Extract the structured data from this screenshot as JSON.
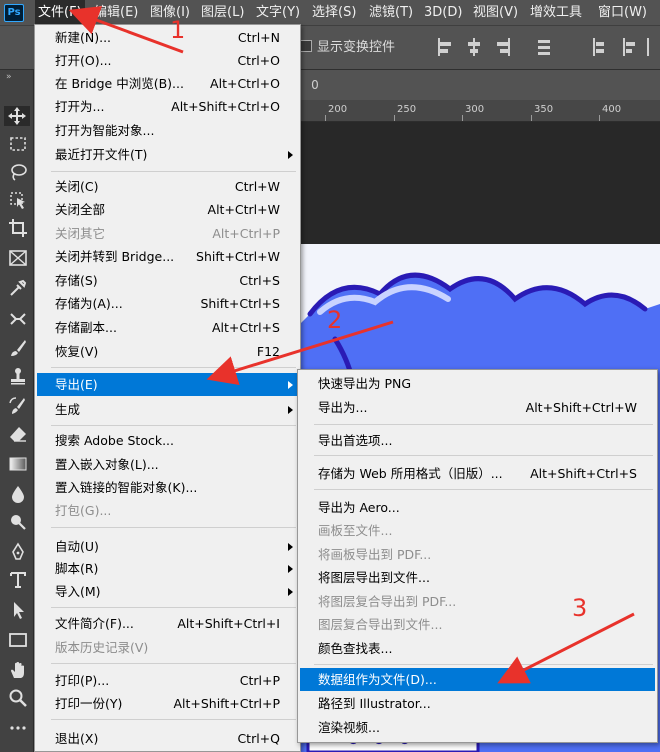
{
  "app": {
    "logo_text": "Ps"
  },
  "menubar": {
    "items": [
      "文件(F)",
      "编辑(E)",
      "图像(I)",
      "图层(L)",
      "文字(Y)",
      "选择(S)",
      "滤镜(T)",
      "3D(D)",
      "视图(V)",
      "增效工具",
      "窗口(W)"
    ]
  },
  "options_bar": {
    "show_transform_controls": "显示变换控件"
  },
  "document": {
    "tab_label": "0"
  },
  "ruler": {
    "ticks": [
      "200",
      "250",
      "300",
      "350",
      "400"
    ]
  },
  "file_menu": {
    "items": [
      {
        "label": "新建(N)...",
        "shortcut": "Ctrl+N",
        "disabled": false
      },
      {
        "label": "打开(O)...",
        "shortcut": "Ctrl+O",
        "disabled": false
      },
      {
        "label": "在 Bridge 中浏览(B)...",
        "shortcut": "Alt+Ctrl+O",
        "disabled": false
      },
      {
        "label": "打开为...",
        "shortcut": "Alt+Shift+Ctrl+O",
        "disabled": false
      },
      {
        "label": "打开为智能对象...",
        "shortcut": "",
        "disabled": false
      },
      {
        "label": "最近打开文件(T)",
        "shortcut": "",
        "disabled": false,
        "submenu": true
      },
      {
        "label": "关闭(C)",
        "shortcut": "Ctrl+W",
        "disabled": false
      },
      {
        "label": "关闭全部",
        "shortcut": "Alt+Ctrl+W",
        "disabled": false
      },
      {
        "label": "关闭其它",
        "shortcut": "Alt+Ctrl+P",
        "disabled": true
      },
      {
        "label": "关闭并转到 Bridge...",
        "shortcut": "Shift+Ctrl+W",
        "disabled": false
      },
      {
        "label": "存储(S)",
        "shortcut": "Ctrl+S",
        "disabled": false
      },
      {
        "label": "存储为(A)...",
        "shortcut": "Shift+Ctrl+S",
        "disabled": false
      },
      {
        "label": "存储副本...",
        "shortcut": "Alt+Ctrl+S",
        "disabled": false
      },
      {
        "label": "恢复(V)",
        "shortcut": "F12",
        "disabled": false
      },
      {
        "label": "导出(E)",
        "shortcut": "",
        "disabled": false,
        "submenu": true,
        "highlighted": true
      },
      {
        "label": "生成",
        "shortcut": "",
        "disabled": false,
        "submenu": true
      },
      {
        "label": "搜索 Adobe Stock...",
        "shortcut": "",
        "disabled": false
      },
      {
        "label": "置入嵌入对象(L)...",
        "shortcut": "",
        "disabled": false
      },
      {
        "label": "置入链接的智能对象(K)...",
        "shortcut": "",
        "disabled": false
      },
      {
        "label": "打包(G)...",
        "shortcut": "",
        "disabled": true
      },
      {
        "label": "自动(U)",
        "shortcut": "",
        "disabled": false,
        "submenu": true
      },
      {
        "label": "脚本(R)",
        "shortcut": "",
        "disabled": false,
        "submenu": true
      },
      {
        "label": "导入(M)",
        "shortcut": "",
        "disabled": false,
        "submenu": true
      },
      {
        "label": "文件简介(F)...",
        "shortcut": "Alt+Shift+Ctrl+I",
        "disabled": false
      },
      {
        "label": "版本历史记录(V)",
        "shortcut": "",
        "disabled": true
      },
      {
        "label": "打印(P)...",
        "shortcut": "Ctrl+P",
        "disabled": false
      },
      {
        "label": "打印一份(Y)",
        "shortcut": "Alt+Shift+Ctrl+P",
        "disabled": false
      },
      {
        "label": "退出(X)",
        "shortcut": "Ctrl+Q",
        "disabled": false
      }
    ]
  },
  "export_submenu": {
    "items": [
      {
        "label": "快速导出为 PNG",
        "shortcut": "",
        "disabled": false
      },
      {
        "label": "导出为...",
        "shortcut": "Alt+Shift+Ctrl+W",
        "disabled": false
      },
      {
        "label": "导出首选项...",
        "shortcut": "",
        "disabled": false
      },
      {
        "label": "存储为 Web 所用格式（旧版）...",
        "shortcut": "Alt+Shift+Ctrl+S",
        "disabled": false
      },
      {
        "label": "导出为 Aero...",
        "shortcut": "",
        "disabled": false
      },
      {
        "label": "画板至文件...",
        "shortcut": "",
        "disabled": true
      },
      {
        "label": "将画板导出到 PDF...",
        "shortcut": "",
        "disabled": true
      },
      {
        "label": "将图层导出到文件...",
        "shortcut": "",
        "disabled": false
      },
      {
        "label": "将图层复合导出到 PDF...",
        "shortcut": "",
        "disabled": true
      },
      {
        "label": "图层复合导出到文件...",
        "shortcut": "",
        "disabled": true
      },
      {
        "label": "颜色查找表...",
        "shortcut": "",
        "disabled": false
      },
      {
        "label": "数据组作为文件(D)...",
        "shortcut": "",
        "disabled": false,
        "highlighted": true
      },
      {
        "label": "路径到 Illustrator...",
        "shortcut": "",
        "disabled": false
      },
      {
        "label": "渲染视频...",
        "shortcut": "",
        "disabled": false
      }
    ]
  },
  "annotations": {
    "steps": [
      "1",
      "2",
      "3"
    ],
    "color": "#e8322b"
  },
  "colors": {
    "highlight": "#0078d7",
    "menu_bg": "#f0f0f0",
    "artwork_blue": "#4f6ff5"
  }
}
